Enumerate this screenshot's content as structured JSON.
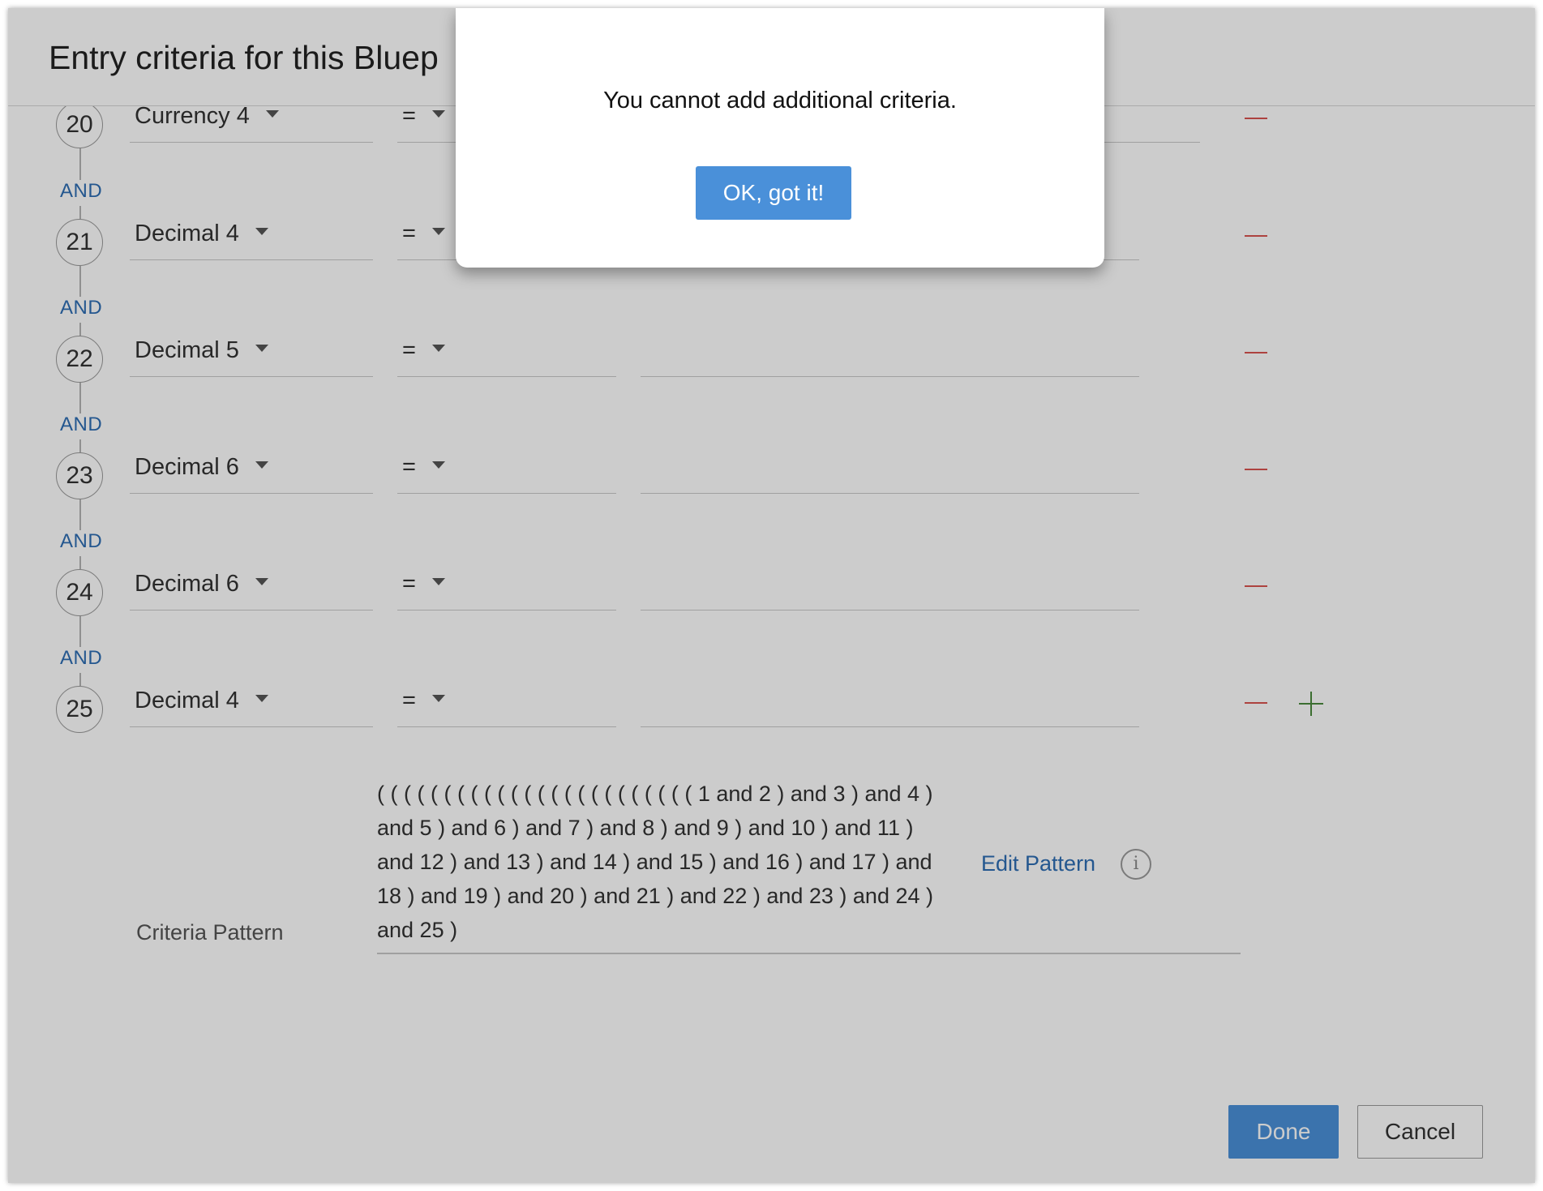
{
  "header": {
    "title": "Entry criteria for this Bluep"
  },
  "criteria": [
    {
      "number": "20",
      "field": "Currency 4",
      "operator": "=",
      "value": ""
    },
    {
      "number": "21",
      "field": "Decimal 4",
      "operator": "=",
      "value": ""
    },
    {
      "number": "22",
      "field": "Decimal 5",
      "operator": "=",
      "value": ""
    },
    {
      "number": "23",
      "field": "Decimal 6",
      "operator": "=",
      "value": ""
    },
    {
      "number": "24",
      "field": "Decimal 6",
      "operator": "=",
      "value": ""
    },
    {
      "number": "25",
      "field": "Decimal 4",
      "operator": "=",
      "value": ""
    }
  ],
  "connector": "AND",
  "pattern": {
    "label": "Criteria Pattern",
    "text": "( ( ( ( ( ( ( ( ( ( ( ( ( ( ( ( ( ( ( ( ( ( ( ( 1 and 2 ) and 3 ) and 4 ) and 5 ) and 6 ) and 7 ) and 8 ) and 9 ) and 10 ) and 11 ) and 12 ) and 13 ) and 14 ) and 15 ) and 16 ) and 17 ) and 18 ) and 19 ) and 20 ) and 21 ) and 22 ) and 23 ) and 24 ) and 25 )",
    "edit_label": "Edit Pattern",
    "info_glyph": "i"
  },
  "footer": {
    "done_label": "Done",
    "cancel_label": "Cancel"
  },
  "modal": {
    "message": "You cannot add additional criteria.",
    "ok_label": "OK, got it!"
  },
  "colors": {
    "accent": "#4a90d9",
    "link": "#2e6db3",
    "remove": "#d9534f",
    "add": "#4a8a3c"
  }
}
